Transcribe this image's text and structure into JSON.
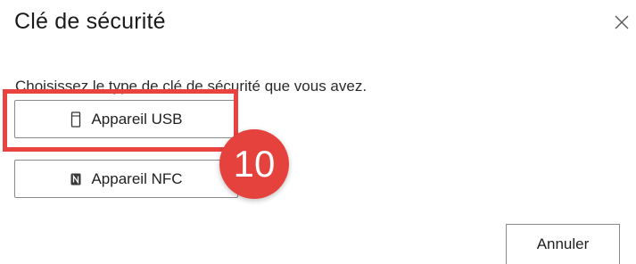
{
  "dialog": {
    "title": "Clé de sécurité",
    "close_icon": "close-icon",
    "instruction": "Choisissez le type de clé de sécurité que vous avez.",
    "options": [
      {
        "label": "Appareil USB",
        "icon": "usb-device-icon"
      },
      {
        "label": "Appareil NFC",
        "icon": "nfc-icon"
      }
    ],
    "cancel_label": "Annuler"
  },
  "annotation": {
    "step_number": "10",
    "highlight_color": "#e8433f",
    "badge_color": "#e5413d"
  }
}
